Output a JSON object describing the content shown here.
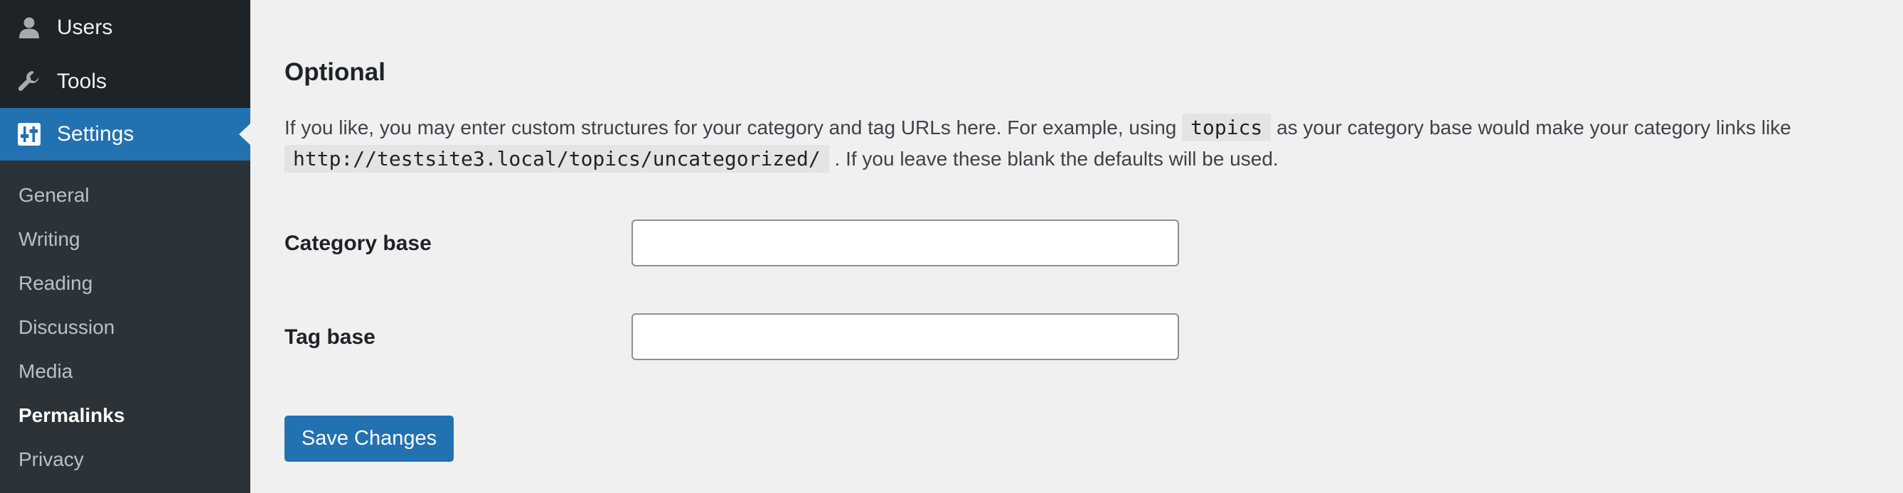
{
  "sidebar": {
    "menu": [
      {
        "label": "Users",
        "icon": "user-icon"
      },
      {
        "label": "Tools",
        "icon": "wrench-icon"
      },
      {
        "label": "Settings",
        "icon": "settings-sliders-icon",
        "active": true
      }
    ],
    "submenu": [
      {
        "label": "General"
      },
      {
        "label": "Writing"
      },
      {
        "label": "Reading"
      },
      {
        "label": "Discussion"
      },
      {
        "label": "Media"
      },
      {
        "label": "Permalinks",
        "current": true
      },
      {
        "label": "Privacy"
      }
    ]
  },
  "main": {
    "section_title": "Optional",
    "description": {
      "part1": "If you like, you may enter custom structures for your category and tag URLs here. For example, using",
      "code1": "topics",
      "part2": "as your category base would make your category links like",
      "code2": "http://testsite3.local/topics/uncategorized/",
      "part3": ". If you leave these blank the defaults will be used."
    },
    "fields": {
      "category_base": {
        "label": "Category base",
        "value": ""
      },
      "tag_base": {
        "label": "Tag base",
        "value": ""
      }
    },
    "save_label": "Save Changes"
  },
  "colors": {
    "sidebar_bg": "#1d2327",
    "submenu_bg": "#2c3338",
    "accent": "#2271b1",
    "page_bg": "#f0f0f1"
  }
}
